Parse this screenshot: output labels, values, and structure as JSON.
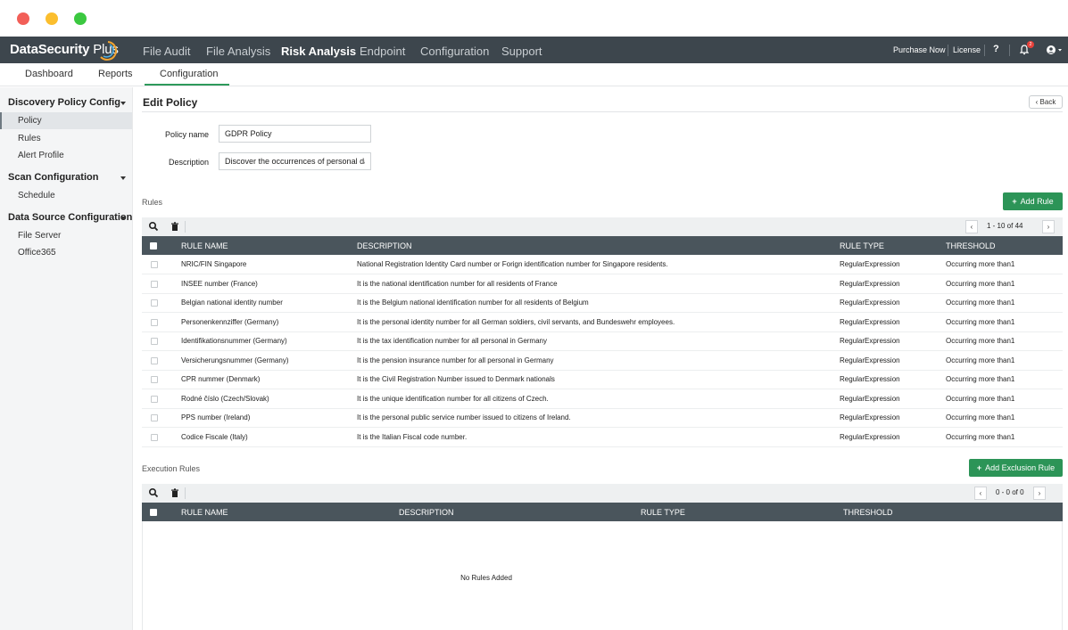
{
  "brand": {
    "name": "DataSecurity",
    "suffix": "Plus"
  },
  "topnav": {
    "items": [
      "File Audit",
      "File Analysis",
      "Risk Analysis",
      "Endpoint",
      "Configuration",
      "Support"
    ],
    "active": "Risk Analysis",
    "purchase_now": "Purchase Now",
    "license": "License",
    "help": "?",
    "notification_count": "2"
  },
  "subnav": {
    "items": [
      "Dashboard",
      "Reports",
      "Configuration"
    ],
    "active": "Configuration"
  },
  "sidebar": {
    "sections": [
      {
        "title": "Discovery Policy Config",
        "items": [
          "Policy",
          "Rules",
          "Alert Profile"
        ]
      },
      {
        "title": "Scan Configuration",
        "items": [
          "Schedule"
        ]
      },
      {
        "title": "Data Source Configuration",
        "items": [
          "File Server",
          "Office365"
        ]
      }
    ],
    "active_item": "Policy"
  },
  "page": {
    "title": "Edit Policy",
    "back_label": "Back"
  },
  "form": {
    "policy_name_label": "Policy name",
    "policy_name_value": "GDPR Policy",
    "description_label": "Description",
    "description_value": "Discover the occurrences of personal data"
  },
  "rules": {
    "section_label": "Rules",
    "add_button": "Add Rule",
    "pager": {
      "range": "1 - 10 of 44",
      "prev": "‹",
      "next": "›"
    },
    "columns": [
      "RULE NAME",
      "DESCRIPTION",
      "RULE TYPE",
      "THRESHOLD"
    ],
    "rows": [
      {
        "name": "NRIC/FIN Singapore",
        "description": "National Registration Identity Card number or Forign identification number for Singapore residents.",
        "type": "RegularExpression",
        "threshold": "Occurring more than1"
      },
      {
        "name": "INSEE number (France)",
        "description": "It is the national identification number for all residents of France",
        "type": "RegularExpression",
        "threshold": "Occurring more than1"
      },
      {
        "name": "Belgian national identity number",
        "description": "It is the Belgium national identification number for all residents of Belgium",
        "type": "RegularExpression",
        "threshold": "Occurring more than1"
      },
      {
        "name": "Personenkennziffer (Germany)",
        "description": "It is the personal identity number for all German soldiers, civil servants, and Bundeswehr employees.",
        "type": "RegularExpression",
        "threshold": "Occurring more than1"
      },
      {
        "name": "Identifikationsnummer (Germany)",
        "description": "It is the tax identification number for all personal in Germany",
        "type": "RegularExpression",
        "threshold": "Occurring more than1"
      },
      {
        "name": "Versicherungsnummer (Germany)",
        "description": "It is the pension insurance number for all personal in Germany",
        "type": "RegularExpression",
        "threshold": "Occurring more than1"
      },
      {
        "name": "CPR nummer (Denmark)",
        "description": "It is the Civil Registration Number issued to Denmark nationals",
        "type": "RegularExpression",
        "threshold": "Occurring more than1"
      },
      {
        "name": "Rodné číslo (Czech/Slovak)",
        "description": "It is the unique identification number for all citizens of Czech.",
        "type": "RegularExpression",
        "threshold": "Occurring more than1"
      },
      {
        "name": "PPS number (Ireland)",
        "description": "It is the personal public service number issued to citizens of Ireland.",
        "type": "RegularExpression",
        "threshold": "Occurring more than1"
      },
      {
        "name": "Codice Fiscale (Italy)",
        "description": "It is the Italian Fiscal code number.",
        "type": "RegularExpression",
        "threshold": "Occurring more than1"
      }
    ]
  },
  "execution": {
    "section_label": "Execution Rules",
    "add_button": "Add Exclusion Rule",
    "pager": {
      "range": "0 - 0 of 0",
      "prev": "‹",
      "next": "›"
    },
    "columns": [
      "RULE NAME",
      "DESCRIPTION",
      "RULE TYPE",
      "THRESHOLD"
    ],
    "empty_message": "No Rules Added"
  },
  "colors": {
    "topnav_bg": "#3d464d",
    "accent_green": "#2c9457",
    "table_header_bg": "#4a555c"
  }
}
